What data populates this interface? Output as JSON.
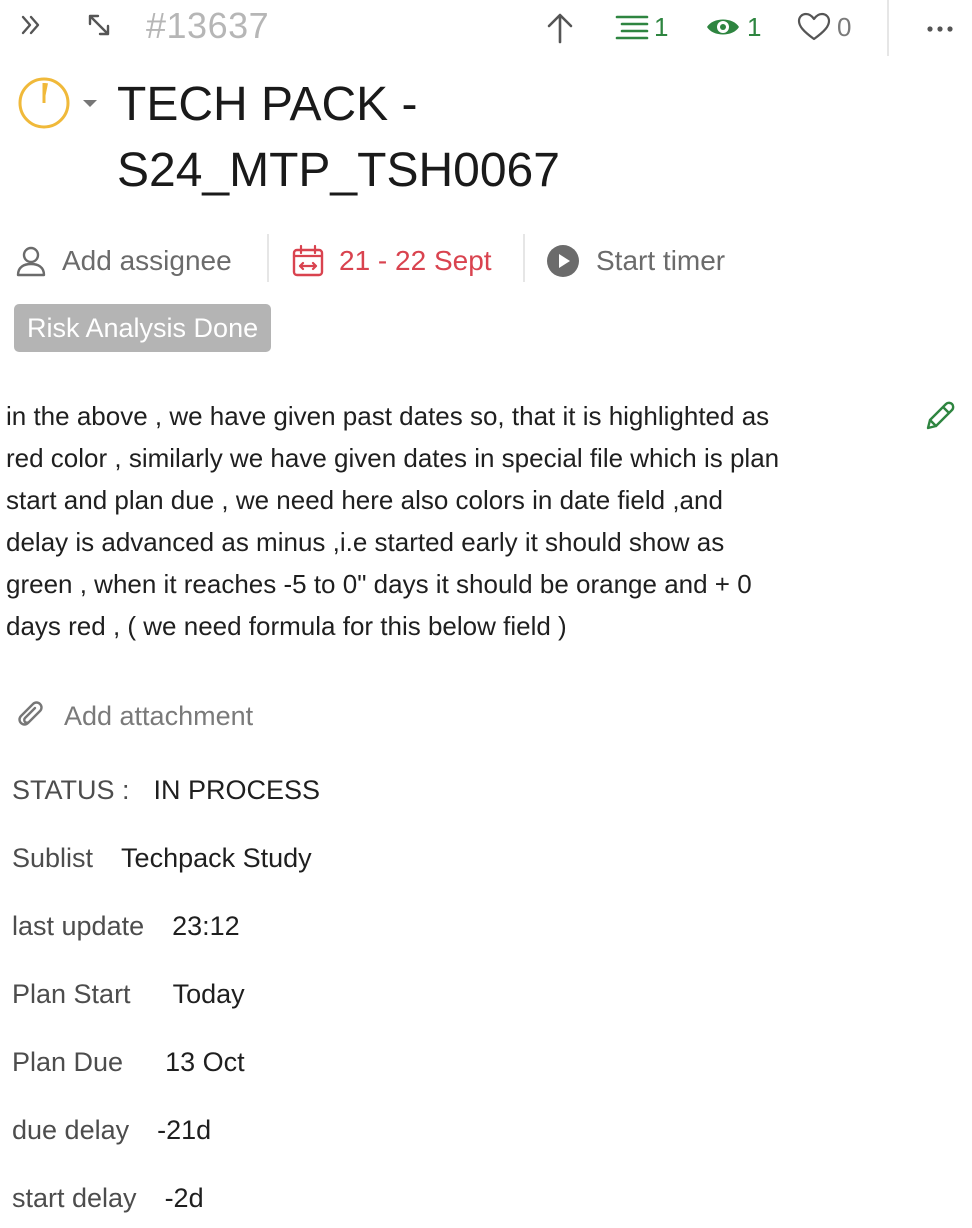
{
  "topbar": {
    "task_id": "#13637",
    "subtasks_count": "1",
    "watchers_count": "1",
    "likes_count": "0",
    "icons": [
      "double-chevron-right-icon",
      "expand-icon",
      "arrow-up-icon",
      "list-icon",
      "eye-icon",
      "heart-icon",
      "more-icon"
    ]
  },
  "title": {
    "line1": "TECH PACK -",
    "line2": "S24_MTP_TSH0067"
  },
  "meta": {
    "assignee_label": "Add assignee",
    "date_range": "21 - 22 Sept",
    "timer_label": "Start timer"
  },
  "tag": {
    "label": "Risk Analysis Done"
  },
  "description": {
    "lines": [
      "in the above , we have given past dates so, that it is highlighted as",
      "red color , similarly we have given dates in special file which is plan",
      "start and plan due , we need here also colors in date field ,and",
      "delay is advanced as minus ,i.e started early it should show as",
      "green , when it reaches -5 to 0\" days it should be orange and + 0",
      "days red , ( we need formula for this below field )"
    ]
  },
  "attachment": {
    "label": "Add attachment"
  },
  "fields": [
    {
      "label": "STATUS :",
      "value": "IN PROCESS"
    },
    {
      "label": "Sublist",
      "value": "Techpack Study"
    },
    {
      "label": "last update",
      "value": "23:12"
    },
    {
      "label": "Plan Start",
      "value": "Today"
    },
    {
      "label": "Plan Due",
      "value": "13 Oct"
    },
    {
      "label": "due delay",
      "value": "-21d"
    },
    {
      "label": "start delay",
      "value": "-2d"
    }
  ],
  "colors": {
    "date_red": "#d9434f",
    "status_ring": "#f0b93a",
    "green": "#2e8540",
    "tag_bg": "#b4b4b4"
  }
}
